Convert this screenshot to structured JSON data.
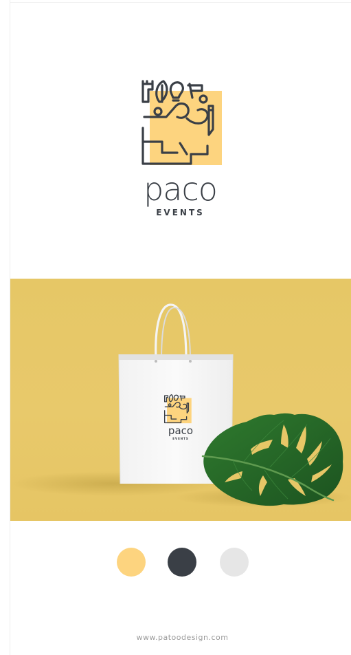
{
  "brand": {
    "name": "paco",
    "tagline": "EVENTS",
    "colors": {
      "accent_yellow": "#fdd47f",
      "dark_slate": "#3a3f46",
      "light_gray": "#e6e6e6"
    }
  },
  "mockup": {
    "background_color": "#e7c767",
    "bag_color": "#f8f8f8",
    "leaf_color": "#2c6b2c",
    "bag_logo_name": "paco",
    "bag_logo_tagline": "EVENTS"
  },
  "palette": [
    {
      "name": "swatch-yellow",
      "hex": "#fdd47f"
    },
    {
      "name": "swatch-slate",
      "hex": "#3a3f46"
    },
    {
      "name": "swatch-gray",
      "hex": "#e6e6e6"
    }
  ],
  "footer": {
    "url": "www.patoodesign.com"
  }
}
